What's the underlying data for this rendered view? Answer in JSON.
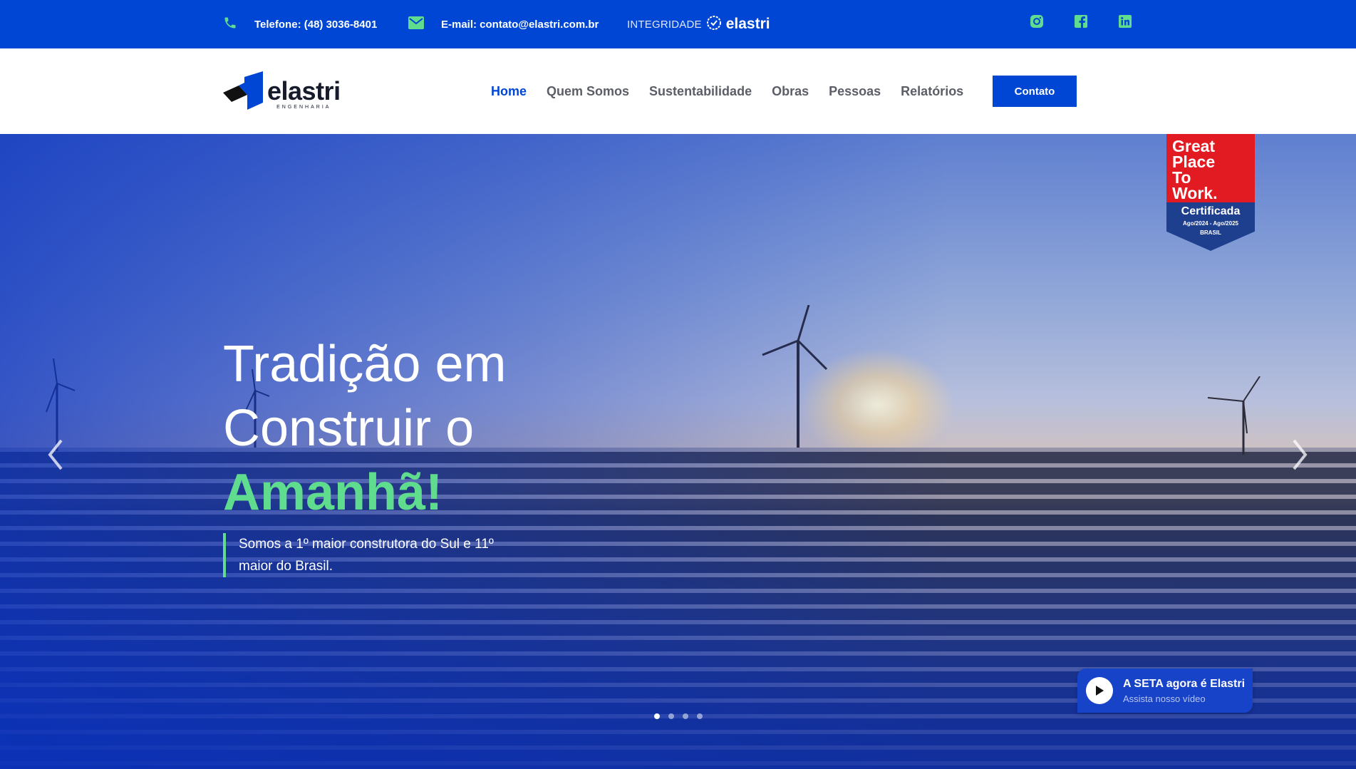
{
  "topbar": {
    "phone": "Telefone: (48) 3036-8401",
    "email": "E-mail: contato@elastri.com.br",
    "integridade_label": "INTEGRIDADE",
    "integridade_brand": "elastri",
    "social": [
      "instagram-icon",
      "facebook-icon",
      "linkedin-icon"
    ],
    "bg_color": "#0046d4",
    "icon_color": "#5fdc8d"
  },
  "header": {
    "logo_name": "elastri",
    "logo_sub": "ENGENHARIA",
    "nav": [
      {
        "label": "Home",
        "active": true
      },
      {
        "label": "Quem Somos"
      },
      {
        "label": "Sustentabilidade"
      },
      {
        "label": "Obras"
      },
      {
        "label": "Pessoas"
      },
      {
        "label": "Relatórios"
      }
    ],
    "cta": "Contato",
    "accent": "#0046d4"
  },
  "hero": {
    "title_line1": "Tradição em",
    "title_line2": "Construir o",
    "title_highlight": "Amanhã!",
    "subtitle": "Somos a 1º maior construtora do Sul e 11º maior do Brasil.",
    "highlight_color": "#5fdc8d",
    "slides": 4,
    "active_slide": 1
  },
  "badge": {
    "lines": [
      "Great",
      "Place",
      "To",
      "Work."
    ],
    "certified": "Certificada",
    "period": "Ago/2024 - Ago/2025",
    "country": "BRASIL"
  },
  "video": {
    "title": "A SETA agora é Elastri",
    "subtitle": "Assista nosso vídeo"
  }
}
